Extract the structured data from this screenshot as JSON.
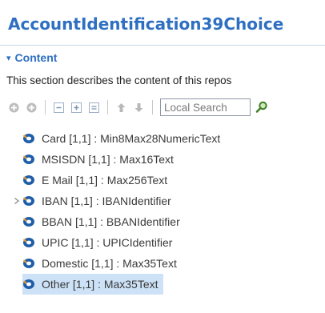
{
  "title": "AccountIdentification39Choice",
  "section": {
    "label": "Content"
  },
  "description": "This section describes the content of this repos",
  "search": {
    "placeholder": "Local Search"
  },
  "tree": {
    "items": [
      {
        "label": "Card [1,1] : Min8Max28NumericText",
        "expandable": false,
        "selected": false
      },
      {
        "label": "MSISDN [1,1] : Max16Text",
        "expandable": false,
        "selected": false
      },
      {
        "label": "E Mail [1,1] : Max256Text",
        "expandable": false,
        "selected": false
      },
      {
        "label": "IBAN [1,1] : IBANIdentifier",
        "expandable": true,
        "selected": false
      },
      {
        "label": "BBAN [1,1] : BBANIdentifier",
        "expandable": false,
        "selected": false
      },
      {
        "label": "UPIC [1,1] : UPICIdentifier",
        "expandable": false,
        "selected": false
      },
      {
        "label": "Domestic [1,1] : Max35Text",
        "expandable": false,
        "selected": false
      },
      {
        "label": "Other [1,1] : Max35Text",
        "expandable": false,
        "selected": true
      }
    ]
  },
  "colors": {
    "title": "#2e6fc2",
    "selection": "#cde2f7",
    "element_icon": "#1f5ea8"
  }
}
